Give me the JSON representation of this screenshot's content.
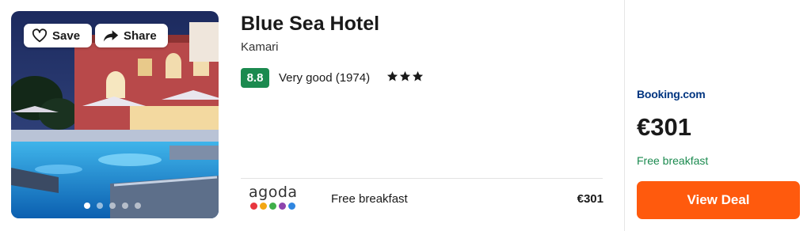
{
  "photo": {
    "save_label": "Save",
    "share_label": "Share",
    "save_icon": "heart-icon",
    "share_icon": "share-arrow-icon",
    "dot_count": 5,
    "active_dot": 0
  },
  "hotel": {
    "name": "Blue Sea Hotel",
    "location": "Kamari",
    "score": "8.8",
    "rating_text": "Very good (1974)",
    "stars": 3
  },
  "offers": [
    {
      "provider_logo": "agoda",
      "provider_logo_text": "agoda",
      "label": "Free breakfast",
      "price": "€301"
    }
  ],
  "featured": {
    "provider": "Booking.com",
    "price": "€301",
    "note": "Free breakfast",
    "button_label": "View Deal"
  },
  "colors": {
    "score_badge": "#1b8a4f",
    "deal_button": "#ff5a0d",
    "provider_blue": "#003580",
    "note_green": "#1b8a4f",
    "agoda_dots": [
      "#e8363f",
      "#f3a712",
      "#3fae49",
      "#8e44ad",
      "#2f86e0"
    ]
  }
}
